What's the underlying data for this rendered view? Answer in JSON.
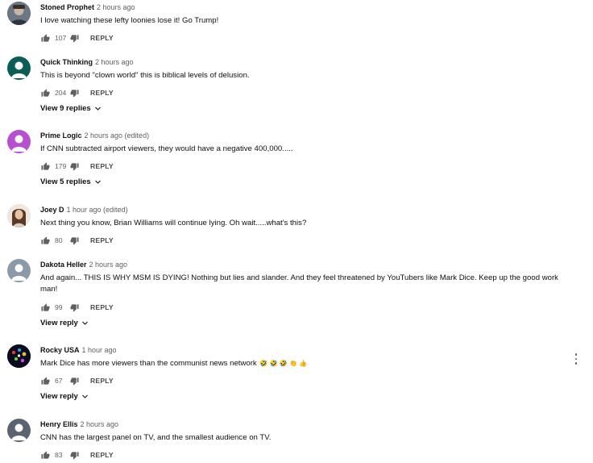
{
  "comments": [
    {
      "author": "Stoned Prophet",
      "time": "2 hours ago",
      "text": "I love watching these lefty loonies lose it! Go Trump!",
      "likes": "107",
      "reply_label": "REPLY",
      "avatar_color": "#5a6470"
    },
    {
      "author": "Quick Thinking",
      "time": "2 hours ago",
      "text": "This is beyond \"clown world\" this is biblical levels of delusion.",
      "likes": "204",
      "reply_label": "REPLY",
      "view_replies": "View 9 replies",
      "avatar_color": "#0b5e55"
    },
    {
      "author": "Prime Logic",
      "time": "2 hours ago (edited)",
      "text": "If CNN subtracted airport viewers, they would have a negative 400,000.....",
      "likes": "179",
      "reply_label": "REPLY",
      "view_replies": "View 5 replies",
      "avatar_color": "#b64fd0"
    },
    {
      "author": "Joey D",
      "time": "1 hour ago (edited)",
      "text": "Next thing you know,  Brian Williams will continue lying.  Oh wait.....what's this?",
      "likes": "80",
      "reply_label": "REPLY",
      "avatar_color": "#c9a98a"
    },
    {
      "author": "Dakota Heller",
      "time": "2 hours ago",
      "text": "And again... THIS IS WHY MSM IS DYING! Nothing but lies and slander. And they feel threatened by YouTubers like Mark Dice. Keep up the good work man!",
      "likes": "99",
      "reply_label": "REPLY",
      "view_replies": "View reply",
      "avatar_color": "#8a9aa8"
    },
    {
      "author": "Rocky USA",
      "time": "1 hour ago",
      "text": "Mark Dice has more viewers than the communist news network",
      "emojis": "🤣 🤣 🤣 👏 👍",
      "likes": "67",
      "reply_label": "REPLY",
      "view_replies": "View reply",
      "avatar_color": "#10102a"
    },
    {
      "author": "Henry Ellis",
      "time": "2 hours ago",
      "text": "CNN has the largest panel on TV, and the smallest audience on TV.",
      "likes": "83",
      "reply_label": "REPLY",
      "avatar_color": "#5a6470"
    }
  ],
  "icons": {
    "like": "thumbs-up-icon",
    "dislike": "thumbs-down-icon",
    "expand": "chevron-down-icon",
    "more": "more-vert-icon"
  },
  "colors": {
    "text": "#0f0f0f",
    "secondary": "#606060"
  }
}
